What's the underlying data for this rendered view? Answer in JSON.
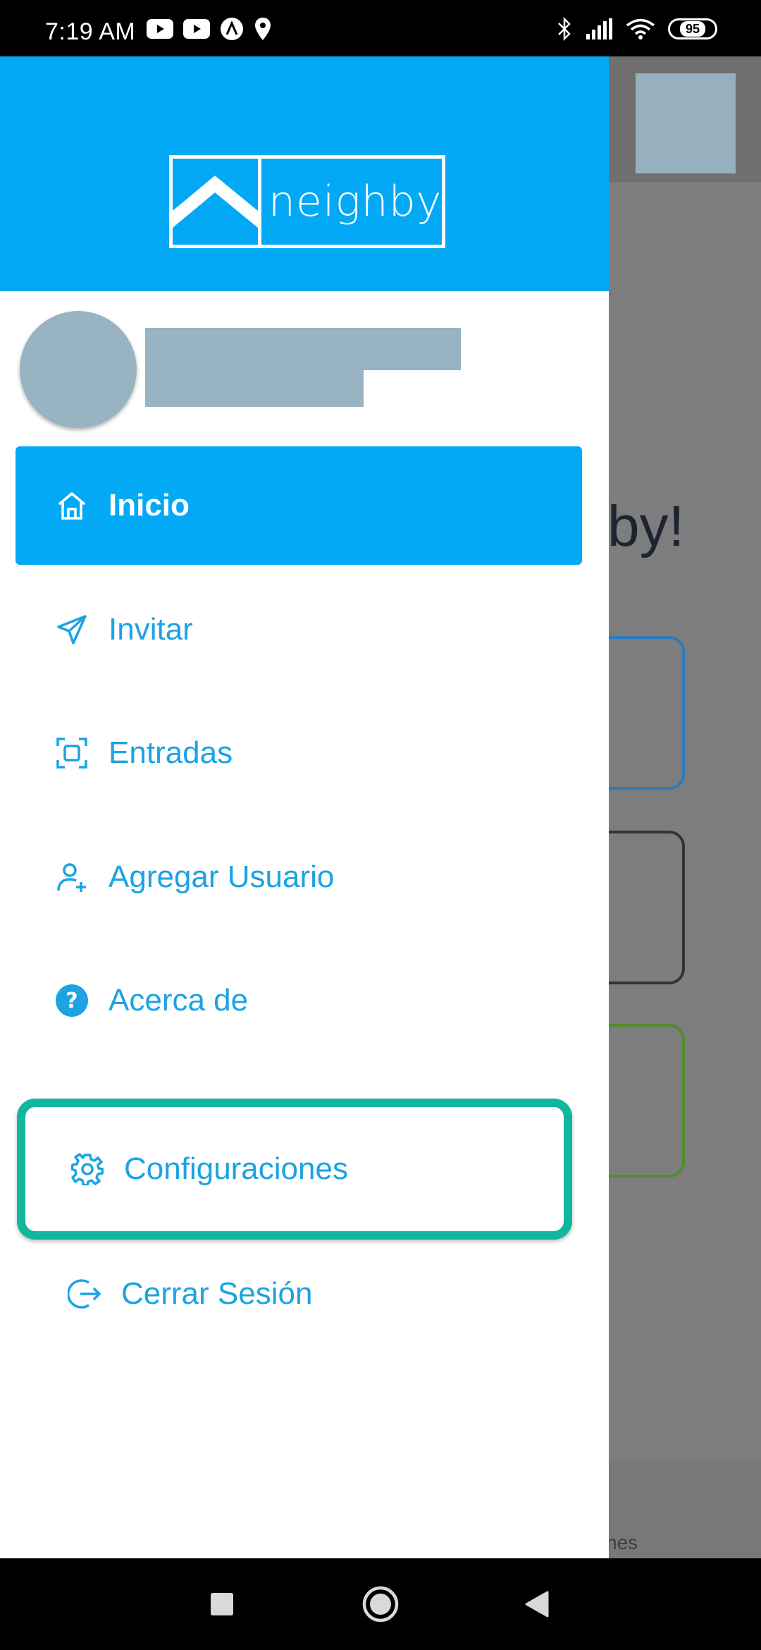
{
  "status_bar": {
    "time": "7:19 AM",
    "battery": "95"
  },
  "drawer": {
    "logo_text": "neighby",
    "menu": [
      {
        "label": "Inicio",
        "icon": "home-icon",
        "active": true
      },
      {
        "label": "Invitar",
        "icon": "send-icon"
      },
      {
        "label": "Entradas",
        "icon": "scan-icon"
      },
      {
        "label": "Agregar Usuario",
        "icon": "add-user-icon"
      },
      {
        "label": "Acerca de",
        "icon": "help-icon"
      },
      {
        "label": "Configuraciones",
        "icon": "gear-icon",
        "highlighted": true
      },
      {
        "label": "Cerrar Sesión",
        "icon": "logout-icon"
      }
    ]
  },
  "background": {
    "title_fragment": "by!",
    "bottom_fragment": "nes"
  },
  "colors": {
    "primary": "#03a9f4",
    "menu_text": "#1ba3e3",
    "highlight": "#10b79e"
  }
}
